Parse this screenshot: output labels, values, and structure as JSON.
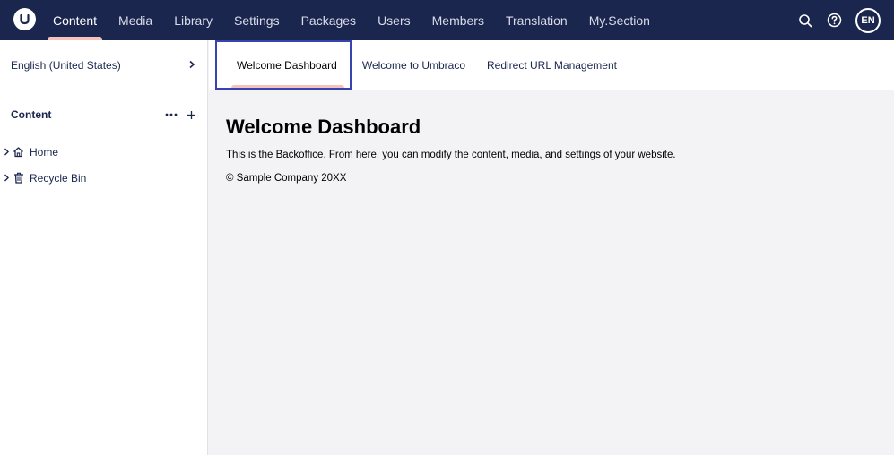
{
  "topbar": {
    "logo_letter": "U",
    "nav": [
      {
        "label": "Content",
        "active": true
      },
      {
        "label": "Media"
      },
      {
        "label": "Library"
      },
      {
        "label": "Settings"
      },
      {
        "label": "Packages"
      },
      {
        "label": "Users"
      },
      {
        "label": "Members"
      },
      {
        "label": "Translation"
      },
      {
        "label": "My.Section"
      }
    ],
    "icons": [
      "search-icon",
      "help-icon"
    ],
    "avatar": "EN"
  },
  "sidebar": {
    "language": "English (United States)",
    "tree_title": "Content",
    "items": [
      {
        "label": "Home",
        "icon": "home-icon"
      },
      {
        "label": "Recycle Bin",
        "icon": "trash-icon"
      }
    ]
  },
  "main": {
    "tabs": [
      {
        "label": "Welcome Dashboard",
        "active": true
      },
      {
        "label": "Welcome to Umbraco"
      },
      {
        "label": "Redirect URL Management"
      }
    ],
    "heading": "Welcome Dashboard",
    "description": "This is the Backoffice. From here, you can modify the content, media, and settings of your website.",
    "footer": "© Sample Company 20XX"
  },
  "colors": {
    "header_bg": "#1b264f",
    "accent": "#f5c1bc",
    "focus_outline": "#3544b1"
  }
}
